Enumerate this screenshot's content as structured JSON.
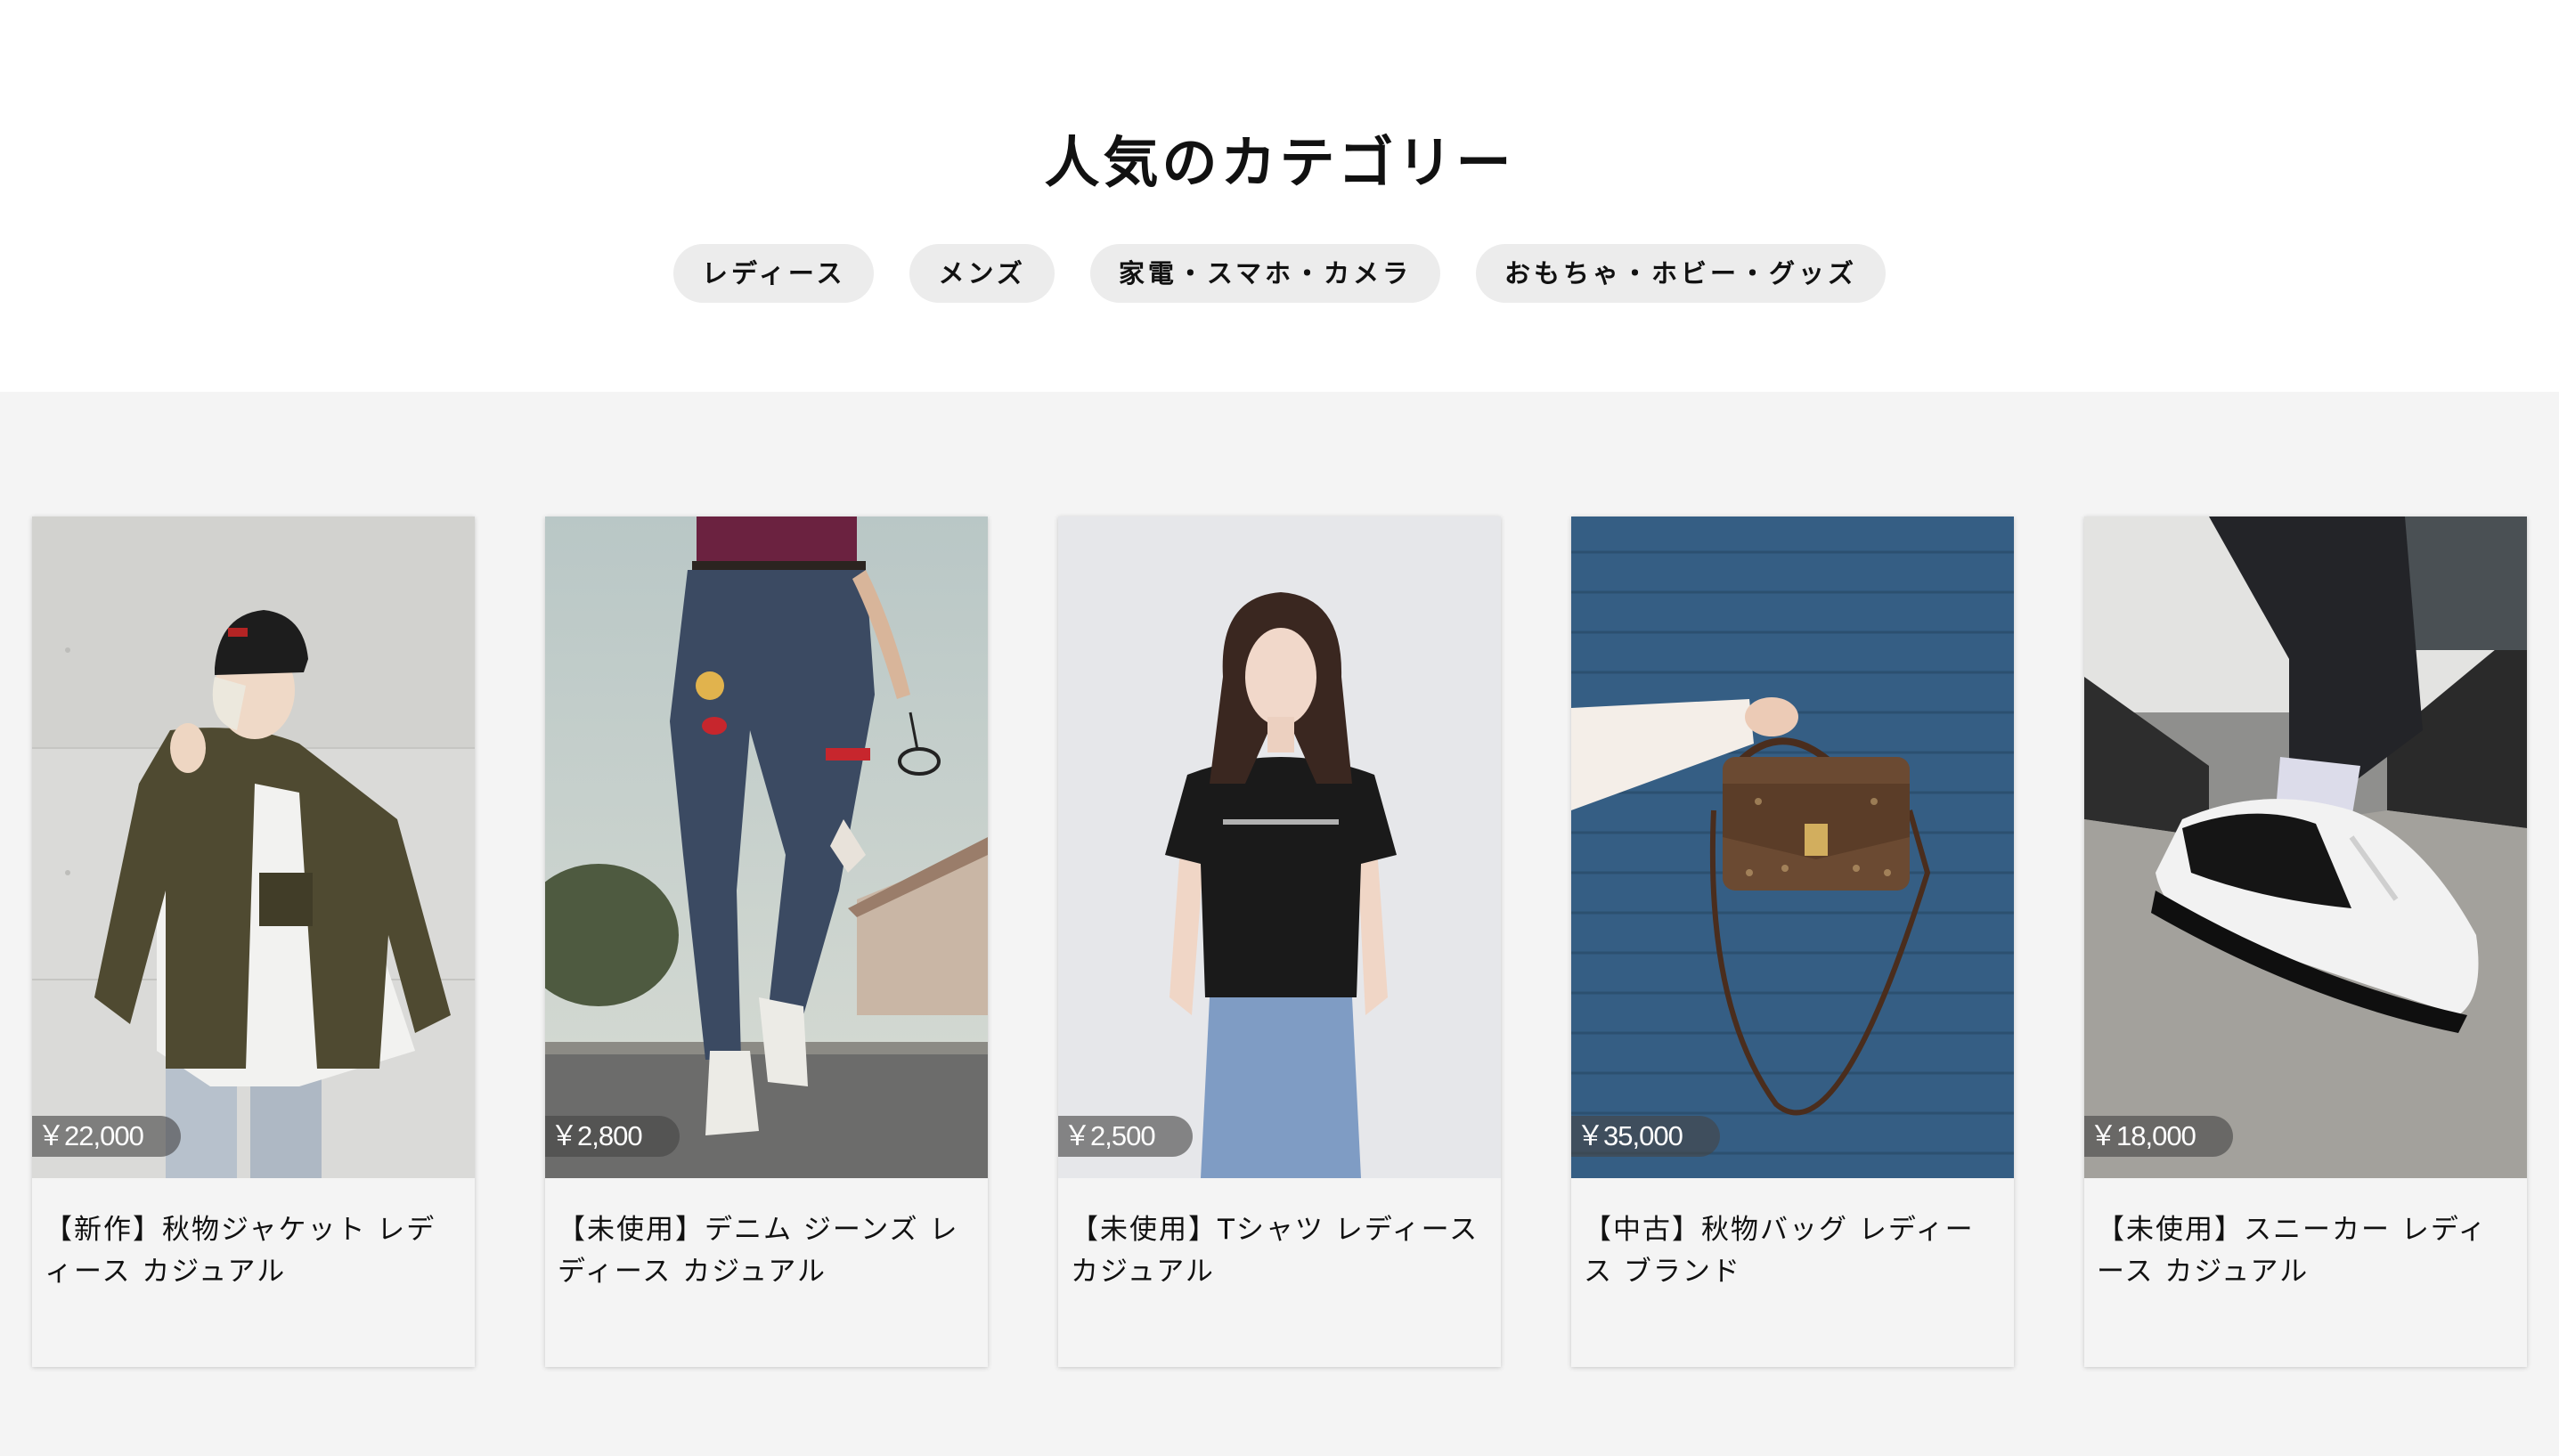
{
  "section": {
    "title": "人気のカテゴリー"
  },
  "categories": [
    {
      "label": "レディース"
    },
    {
      "label": "メンズ"
    },
    {
      "label": "家電・スマホ・カメラ"
    },
    {
      "label": "おもちゃ・ホビー・グッズ"
    }
  ],
  "products": [
    {
      "price": "￥22,000",
      "title": "【新作】秋物ジャケット レディース カジュアル",
      "image": "woman-olive-jacket-beanie"
    },
    {
      "price": "￥2,800",
      "title": "【未使用】デニム ジーンズ レディース カジュアル",
      "image": "distressed-jeans-with-patches"
    },
    {
      "price": "￥2,500",
      "title": "【未使用】Tシャツ レディース カジュアル",
      "image": "woman-black-tshirt"
    },
    {
      "price": "￥35,000",
      "title": "【中古】秋物バッグ レディース ブランド",
      "image": "monogram-handbag-blue-wall"
    },
    {
      "price": "￥18,000",
      "title": "【未使用】スニーカー レディース カジュアル",
      "image": "black-white-sneaker"
    }
  ],
  "colors": {
    "chip_background": "#ececec",
    "section_background": "#f4f4f4",
    "price_badge": "#464646"
  }
}
